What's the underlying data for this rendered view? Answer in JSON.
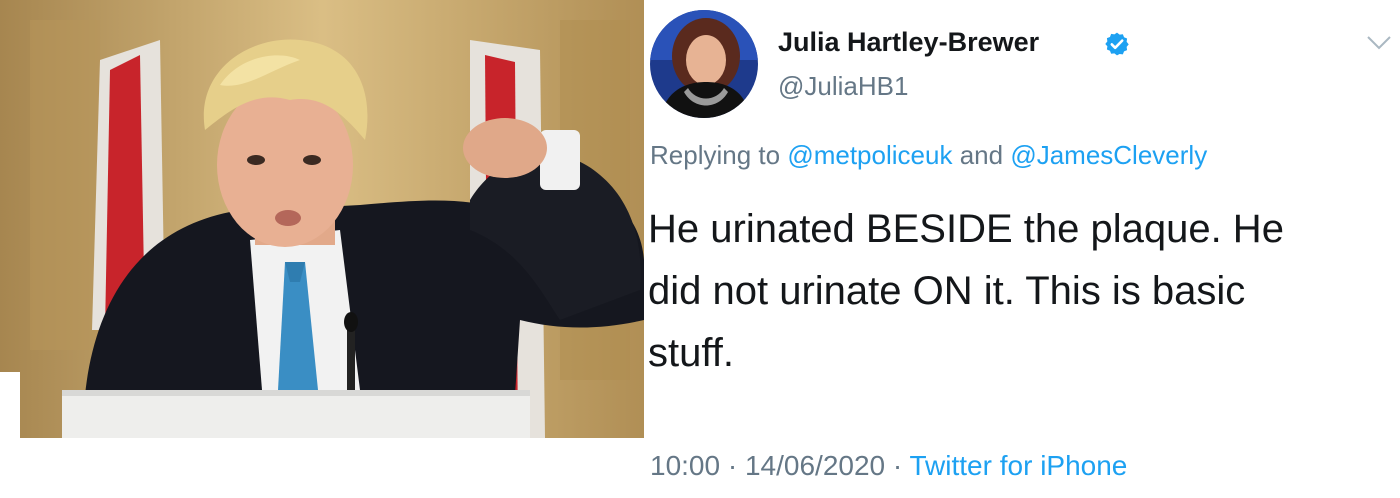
{
  "author": {
    "name": "Julia Hartley-Brewer",
    "handle": "@JuliaHB1",
    "verified": true
  },
  "reply": {
    "prefix": "Replying to",
    "mentions": [
      "@metpoliceuk",
      "@JamesCleverly"
    ],
    "joiner": "and"
  },
  "tweet": {
    "lines": [
      "He urinated BESIDE the plaque. He",
      "did not urinate ON it. This is basic",
      "stuff."
    ]
  },
  "meta": {
    "time": "10:00",
    "separator": "·",
    "date": "14/06/2020",
    "source": "Twitter for iPhone"
  },
  "icons": {
    "verified_badge": "verified-icon",
    "more": "chevron-down-icon"
  },
  "colors": {
    "link": "#1da1f2",
    "secondary_text": "#657786",
    "primary_text": "#14171a"
  }
}
